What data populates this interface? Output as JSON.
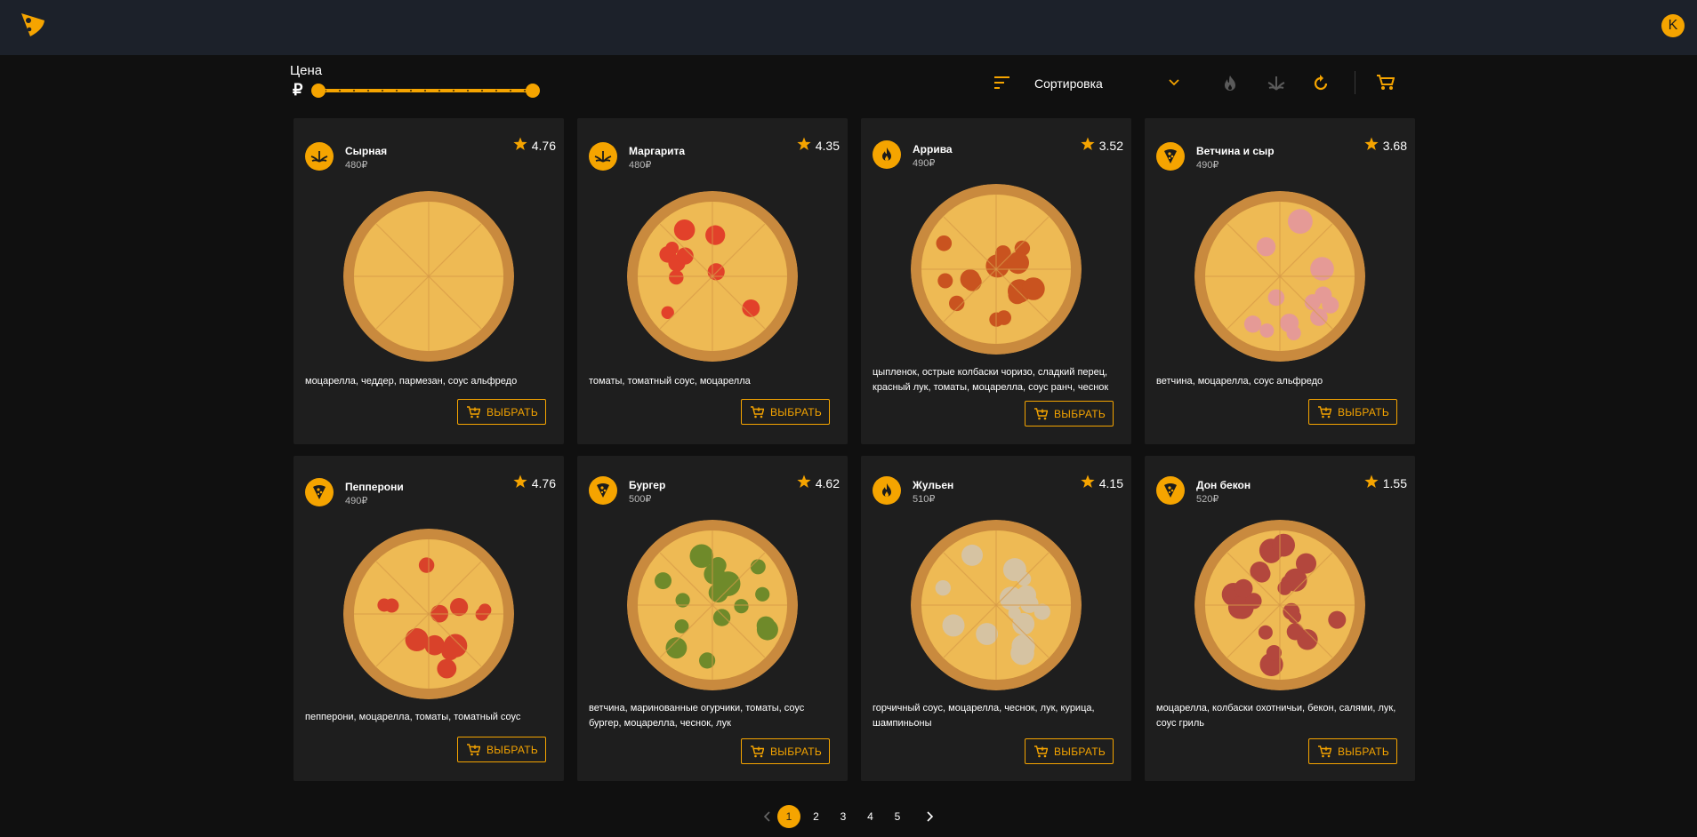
{
  "header": {
    "user_initial": "K"
  },
  "filters": {
    "price_label": "Цена",
    "currency_symbol": "₽",
    "price_range_fraction": [
      0,
      1
    ],
    "sort_label": "Сортировка",
    "filter_icons": [
      "fire-icon",
      "leaf-icon",
      "refresh-icon"
    ]
  },
  "colors": {
    "accent": "#f5a400",
    "card_bg": "#1e1e1e",
    "page_bg": "#101010",
    "topbar_bg": "#1c212a"
  },
  "choose_label": "ВЫБРАТЬ",
  "products": [
    {
      "name": "Сырная",
      "price": "480₽",
      "rating": "4.76",
      "category_icon": "leaf-icon",
      "description": "моцарелла, чеддер, пармезан, соус альфредо"
    },
    {
      "name": "Маргарита",
      "price": "480₽",
      "rating": "4.35",
      "category_icon": "leaf-icon",
      "description": "томаты, томатный соус, моцарелла"
    },
    {
      "name": "Аррива",
      "price": "490₽",
      "rating": "3.52",
      "category_icon": "fire-icon",
      "description": "цыпленок, острые колбаски чоризо, сладкий перец, красный лук, томаты, моцарелла, соус ранч, чеснок"
    },
    {
      "name": "Ветчина и сыр",
      "price": "490₽",
      "rating": "3.68",
      "category_icon": "pizza-slice-icon",
      "description": "ветчина, моцарелла, соус альфредо"
    },
    {
      "name": "Пепперони",
      "price": "490₽",
      "rating": "4.76",
      "category_icon": "pizza-slice-icon",
      "description": "пепперони, моцарелла, томаты, томатный соус"
    },
    {
      "name": "Бургер",
      "price": "500₽",
      "rating": "4.62",
      "category_icon": "pizza-slice-icon",
      "description": "ветчина, маринованные огурчики, томаты, соус бургер, моцарелла, чеснок, лук"
    },
    {
      "name": "Жульен",
      "price": "510₽",
      "rating": "4.15",
      "category_icon": "fire-icon",
      "description": "горчичный соус, моцарелла, чеснок, лук, курица, шампиньоны"
    },
    {
      "name": "Дон бекон",
      "price": "520₽",
      "rating": "1.55",
      "category_icon": "pizza-slice-icon",
      "description": "моцарелла, колбаски охотничьи, бекон, салями, лук, соус гриль"
    }
  ],
  "pagination": {
    "pages": [
      "1",
      "2",
      "3",
      "4",
      "5"
    ],
    "current": "1"
  }
}
